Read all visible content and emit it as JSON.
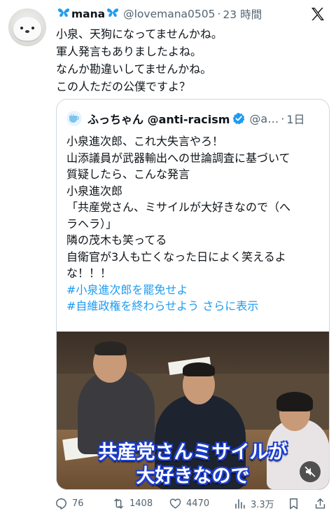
{
  "tweet": {
    "display_name": "mana",
    "handle": "@lovemana0505",
    "separator": "·",
    "time": "23 時間",
    "body_lines": [
      "小泉、天狗になってませんかね。",
      "軍人発言もありましたよね。",
      "なんか勘違いしてませんかね。",
      "この人ただの公僕ですよ？"
    ]
  },
  "quote": {
    "display_name": "ふっちゃん",
    "handle_in_name": "@anti-racism",
    "handle": "@a…",
    "separator": "·",
    "time": "1日",
    "text_lines": [
      "小泉進次郎、これ大失言やろ！",
      "山添議員が武器輸出への世論調査に基づいて",
      "質疑したら、こんな発言",
      "小泉進次郎",
      "「共産党さん、ミサイルが大好きなので（へ",
      "ラヘラ）」",
      "隣の茂木も笑ってる",
      "自衛官が3人も亡くなった日によく笑えるよ",
      "な！！！"
    ],
    "hashtag_1": "#小泉進次郎を罷免せよ",
    "hashtag_2": "#自維政権を終わらせよう",
    "show_more": "さらに表示",
    "video": {
      "subtitle_line_1": "共産党さんミサイルが",
      "subtitle_line_2": "大好きなので"
    }
  },
  "actions": {
    "replies": "76",
    "reposts": "1408",
    "likes": "4470",
    "views": "3.3万"
  },
  "colors": {
    "accent": "#1d9bf0",
    "secondary_text": "#536471",
    "border": "#cfd9de"
  },
  "icons": [
    "butterfly-icon",
    "x-logo-icon",
    "verified-badge-icon",
    "reply-icon",
    "repost-icon",
    "like-icon",
    "views-icon",
    "bookmark-icon",
    "share-icon",
    "mute-icon"
  ]
}
